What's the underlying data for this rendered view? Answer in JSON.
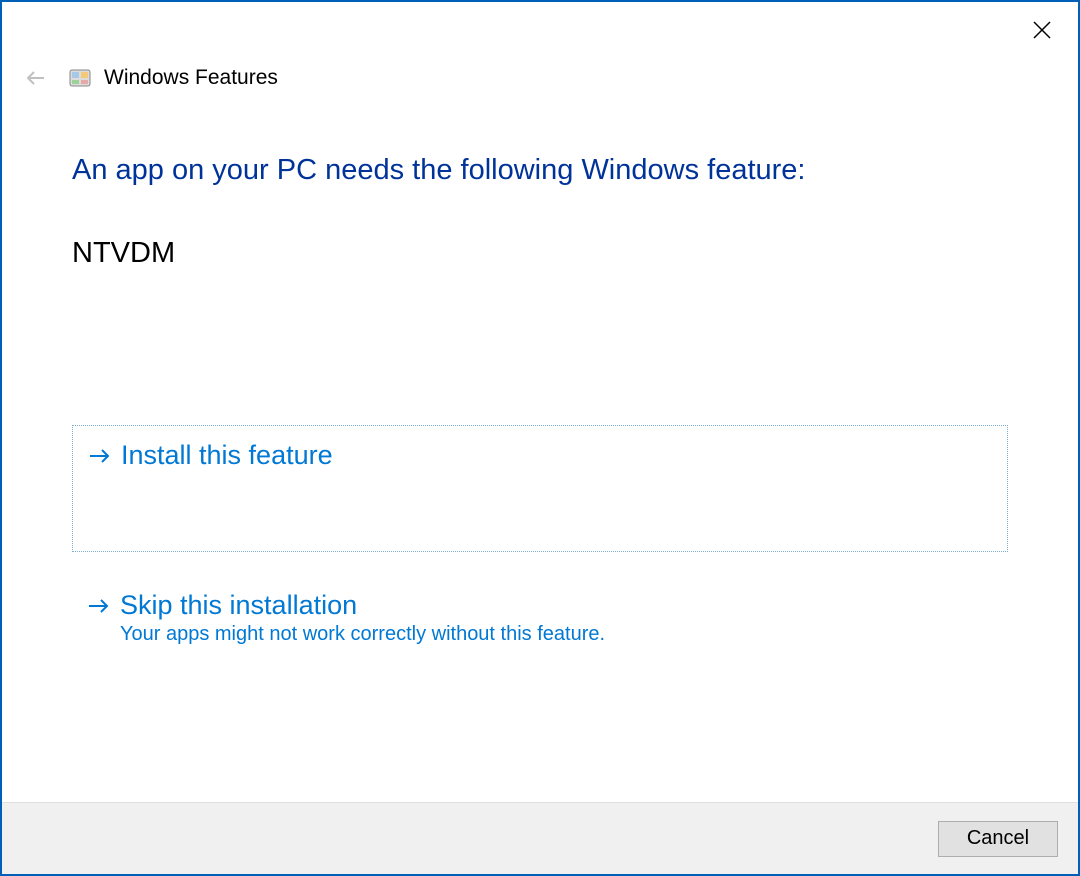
{
  "window": {
    "title": "Windows Features"
  },
  "heading": "An app on your PC needs the following Windows feature:",
  "feature_name": "NTVDM",
  "options": {
    "install": {
      "title": "Install this feature"
    },
    "skip": {
      "title": "Skip this installation",
      "subtext": "Your apps might not work correctly without this feature."
    }
  },
  "footer": {
    "cancel_label": "Cancel"
  }
}
